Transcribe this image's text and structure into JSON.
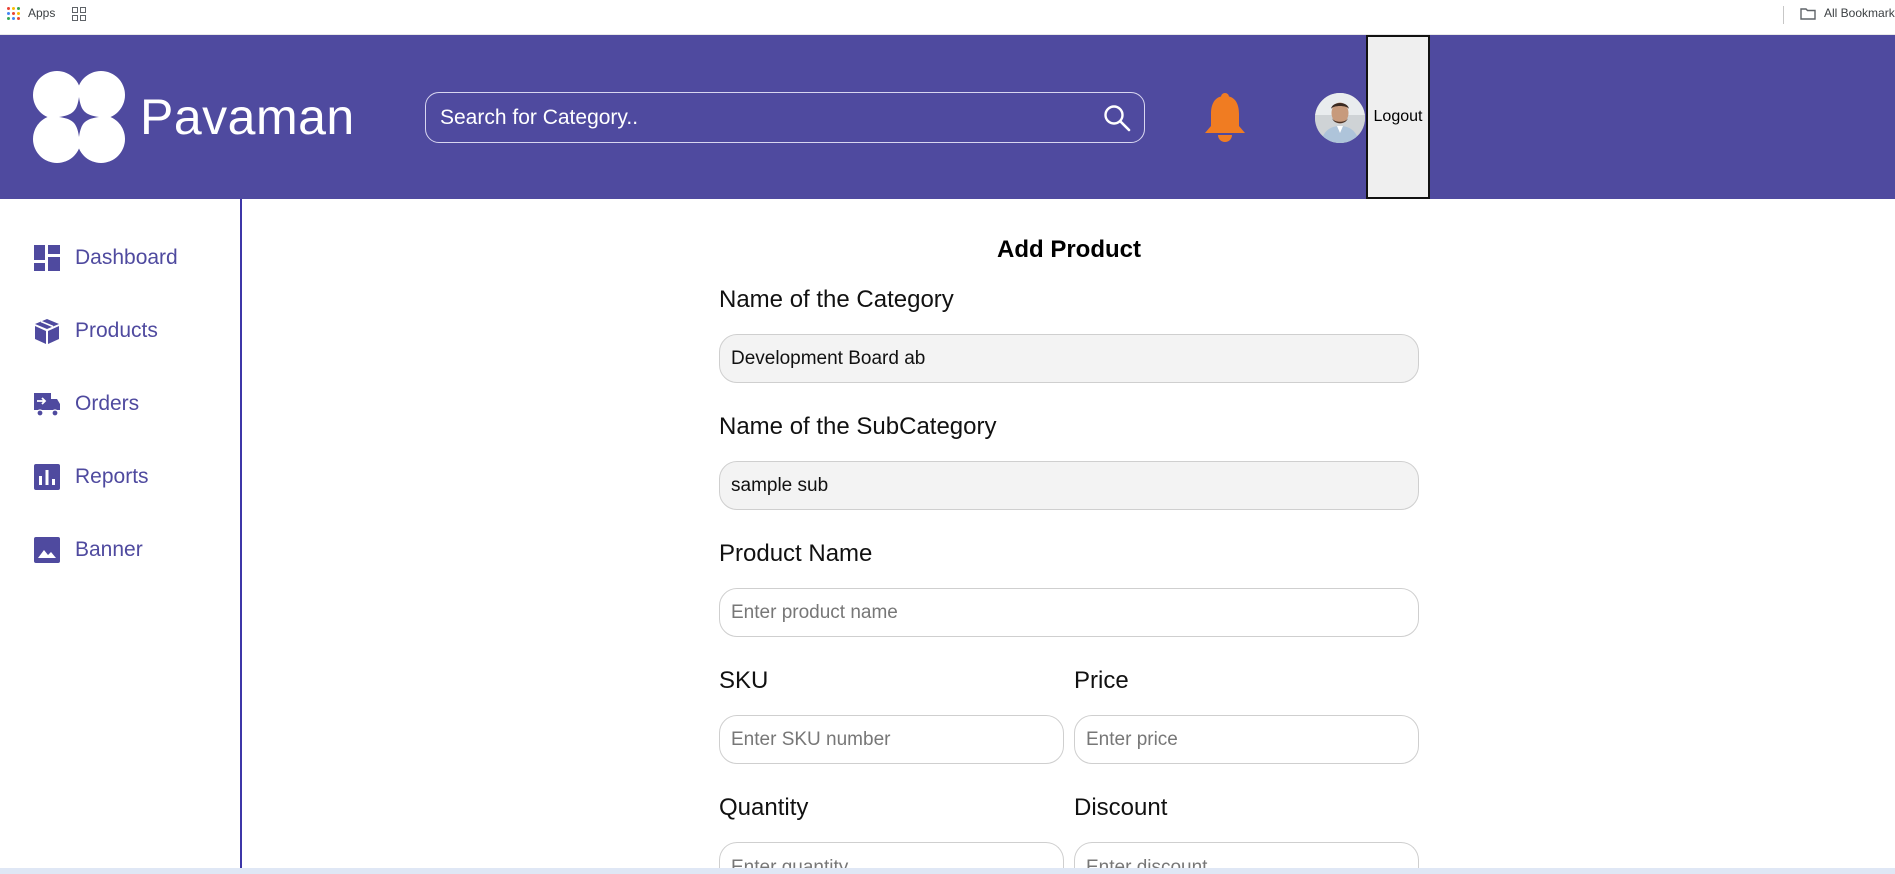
{
  "browser": {
    "apps_label": "Apps",
    "all_bookmarks_label": "All Bookmarks"
  },
  "header": {
    "brand_name": "Pavaman",
    "search_placeholder": "Search for Category..",
    "logout_label": "Logout",
    "colors": {
      "header_bg": "#4f4a9f",
      "bell": "#f07c22",
      "accent": "#3d36a8"
    }
  },
  "sidebar": {
    "items": [
      {
        "label": "Dashboard",
        "icon": "dashboard-icon"
      },
      {
        "label": "Products",
        "icon": "box-icon"
      },
      {
        "label": "Orders",
        "icon": "orders-icon"
      },
      {
        "label": "Reports",
        "icon": "bar-chart-icon"
      },
      {
        "label": "Banner",
        "icon": "image-icon"
      }
    ]
  },
  "form": {
    "title": "Add Product",
    "category_label": "Name of the Category",
    "category_value": "Development Board ab",
    "subcategory_label": "Name of the SubCategory",
    "subcategory_value": "sample sub",
    "product_name_label": "Product Name",
    "product_name_placeholder": "Enter product name",
    "sku_label": "SKU",
    "sku_placeholder": "Enter SKU number",
    "price_label": "Price",
    "price_placeholder": "Enter price",
    "quantity_label": "Quantity",
    "quantity_placeholder": "Enter quantity",
    "discount_label": "Discount",
    "discount_placeholder": "Enter discount"
  }
}
